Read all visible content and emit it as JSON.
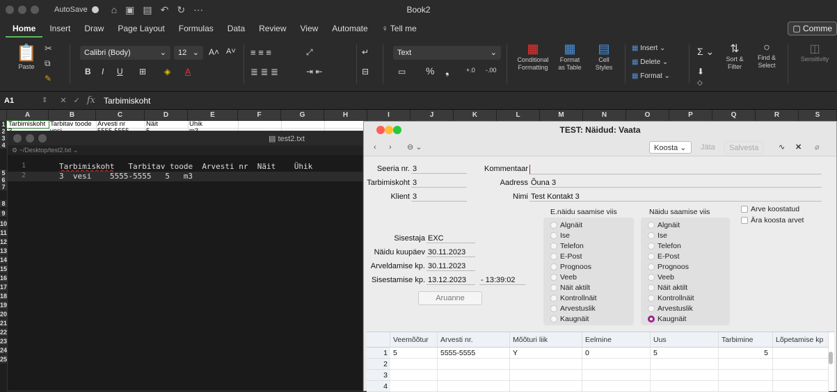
{
  "titlebar": {
    "autosave": "AutoSave",
    "book": "Book2"
  },
  "ribbon_tabs": [
    "Home",
    "Insert",
    "Draw",
    "Page Layout",
    "Formulas",
    "Data",
    "Review",
    "View",
    "Automate",
    "Tell me"
  ],
  "comments_label": "Comme",
  "ribbon": {
    "paste": "Paste",
    "font_name": "Calibri (Body)",
    "font_size": "12",
    "number_format": "Text",
    "conditional": "Conditional\nFormatting",
    "format_table": "Format\nas Table",
    "cell_styles": "Cell\nStyles",
    "insert": "Insert",
    "delete": "Delete",
    "format": "Format",
    "sort_filter": "Sort &\nFilter",
    "find_select": "Find &\nSelect",
    "sensitivity": "Sensitivity"
  },
  "formula": {
    "cell_ref": "A1",
    "fx": "fx",
    "content": "Tarbimiskoht"
  },
  "grid": {
    "columns": [
      "A",
      "B",
      "C",
      "D",
      "E",
      "F",
      "G",
      "H",
      "I",
      "J",
      "K",
      "L",
      "M",
      "N",
      "O",
      "P",
      "Q",
      "R",
      "S"
    ],
    "rows": [
      "1",
      "2",
      "3",
      "4",
      "5",
      "6",
      "7",
      "8",
      "9",
      "10",
      "11",
      "12",
      "13",
      "14",
      "15",
      "16",
      "17",
      "18",
      "19",
      "20",
      "21",
      "22",
      "23",
      "24",
      "25"
    ],
    "row1": [
      "Tarbimiskoht",
      "Tarbitav toode",
      "Arvesti nr",
      "Näit",
      "Ühik"
    ],
    "row2": [
      "3",
      "vesi",
      "5555-5555",
      "5",
      "m3"
    ]
  },
  "editor": {
    "filename": "test2.txt",
    "path": "~/Desktop/test2.txt",
    "line1_num": "1",
    "line2_num": "2",
    "line1_first": "Tarbimiskoht",
    "line1_rest": "   Tarbitav toode  Arvesti nr  Näit    Ühik",
    "line2": "3  vesi    5555-5555   5   m3"
  },
  "test_window": {
    "title": "TEST: Näidud: Vaata",
    "toolbar": {
      "koosta": "Koosta",
      "jata": "Jäta",
      "salvesta": "Salvesta"
    },
    "fields": {
      "seeria_label": "Seeria nr.",
      "seeria": "3",
      "tarbimiskoht_label": "Tarbimiskoht",
      "tarbimiskoht": "3",
      "klient_label": "Klient",
      "klient": "3",
      "kommentaar_label": "Kommentaar",
      "kommentaar": "",
      "aadress_label": "Aadress",
      "aadress": "Õuna 3",
      "nimi_label": "Nimi",
      "nimi": "Test Kontakt 3",
      "sisestaja_label": "Sisestaja",
      "sisestaja": "EXC",
      "kuupaev_label": "Näidu kuupäev",
      "kuupaev": "30.11.2023",
      "arveldamise_label": "Arveldamise kp.",
      "arveldamise": "30.11.2023",
      "sisestamise_label": "Sisestamise kp.",
      "sisestamise": "13.12.2023",
      "sisestamise_time": "- 13:39:02"
    },
    "aruanne": "Aruanne",
    "enaidu_title": "E.näidu saamise viis",
    "naidu_title": "Näidu saamise viis",
    "options": [
      "Algnäit",
      "Ise",
      "Telefon",
      "E-Post",
      "Prognoos",
      "Veeb",
      "Näit aktilt",
      "Kontrollnäit",
      "Arvestuslik",
      "Kaugnäit"
    ],
    "selected_naidu": "Kaugnäit",
    "checks": [
      "Arve koostatud",
      "Ära koosta arvet"
    ],
    "table": {
      "headers": [
        "Veemõõtur",
        "Arvesti nr.",
        "Mõõturi liik",
        "Eelmine",
        "Uus",
        "Tarbimine",
        "Lõpetamise kp"
      ],
      "rows": [
        {
          "n": "1",
          "veemootur": "5",
          "arvesti": "5555-5555",
          "liik": "Y",
          "eelmine": "0",
          "uus": "5",
          "tarbimine": "5",
          "lopetamise": ""
        },
        {
          "n": "2",
          "veemootur": "",
          "arvesti": "",
          "liik": "",
          "eelmine": "",
          "uus": "",
          "tarbimine": "",
          "lopetamise": ""
        },
        {
          "n": "3",
          "veemootur": "",
          "arvesti": "",
          "liik": "",
          "eelmine": "",
          "uus": "",
          "tarbimine": "",
          "lopetamise": ""
        },
        {
          "n": "4",
          "veemootur": "",
          "arvesti": "",
          "liik": "",
          "eelmine": "",
          "uus": "",
          "tarbimine": "",
          "lopetamise": ""
        }
      ]
    }
  }
}
